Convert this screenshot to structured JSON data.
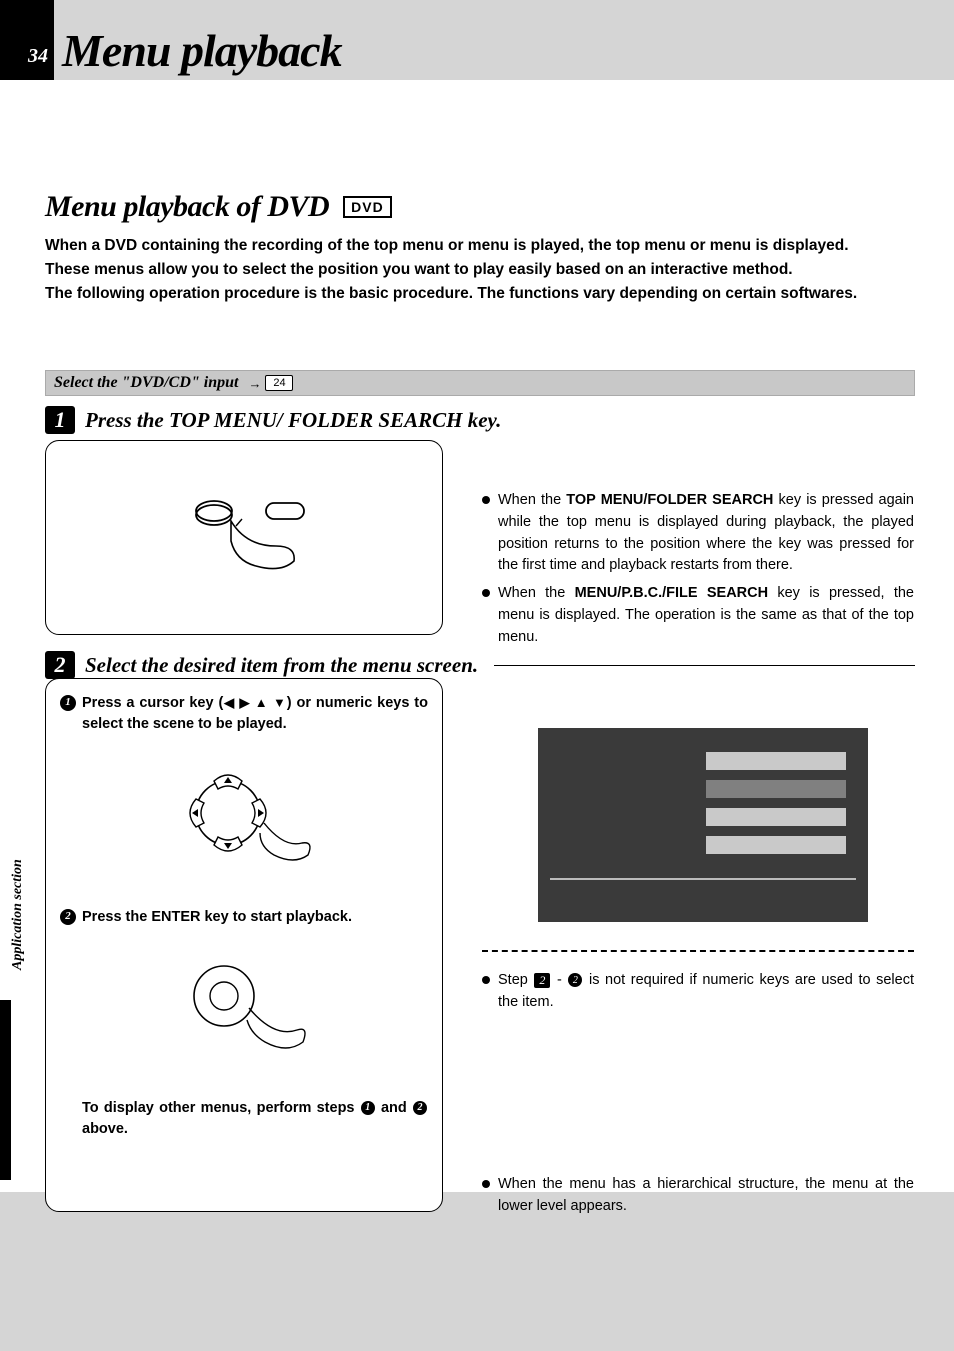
{
  "page_number": "34",
  "title": "Menu playback",
  "subtitle": "Menu playback of DVD",
  "dvd_badge": "DVD",
  "intro_p1": "When a DVD containing the recording of the top menu or menu is played, the top menu or menu is displayed.",
  "intro_p2": "These menus allow you to select the position you want to play easily based on an interactive method.",
  "intro_p3": "The following operation procedure is the basic procedure. The functions vary depending on certain softwares.",
  "grey_bar_text": "Select the \"DVD/CD\" input",
  "grey_bar_ref": "24",
  "step1_num": "1",
  "step1_title": "Press the TOP MENU/ FOLDER SEARCH key.",
  "step2_num": "2",
  "step2_title": "Select the desired item from the menu screen.",
  "sub1_num": "1",
  "sub1_a": "Press a cursor key (",
  "sub1_cursors": "◀ ▶ ▲ ▼",
  "sub1_b": ") or numeric keys to select the scene to be played.",
  "sub2_num": "2",
  "sub2_text": "Press the ENTER key to start playback.",
  "sub_footer": "To display other menus, perform steps ",
  "sub_footer_and": " and ",
  "sub_footer_end": " above.",
  "note1_a": "When the ",
  "note1_key1": "TOP MENU/FOLDER SEARCH",
  "note1_b": " key is pressed again while the top menu is displayed during playback, the played position returns to the position where the key was pressed for the first time and playback restarts from there.",
  "note2_a": "When the ",
  "note2_key": "MENU/P.B.C./FILE SEARCH",
  "note2_b": " key is pressed, the menu is displayed. The operation is the same as that of the top menu.",
  "note3_a": "Step ",
  "note3_mid": " - ",
  "note3_b": " is not required if numeric keys are used to select the item.",
  "note4": "When the menu has a hierarchical structure, the menu at the lower level appears.",
  "sidenote": "Application section"
}
